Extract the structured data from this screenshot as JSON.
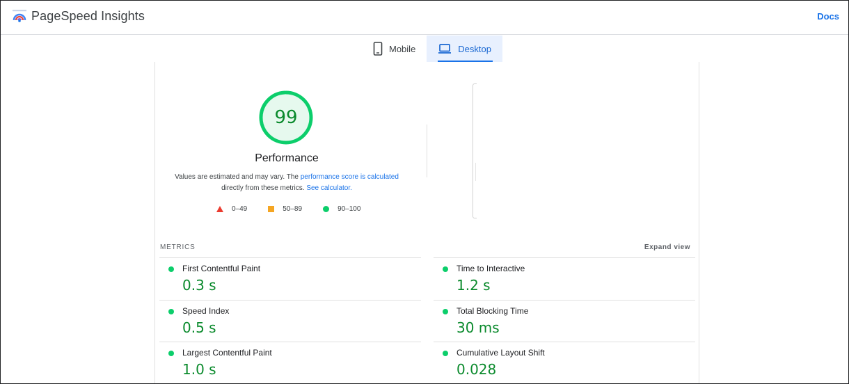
{
  "header": {
    "app_title": "PageSpeed Insights",
    "docs_label": "Docs"
  },
  "tabs": [
    {
      "label": "Mobile",
      "active": false
    },
    {
      "label": "Desktop",
      "active": true
    }
  ],
  "score": {
    "value": "99",
    "fraction": 0.99,
    "label": "Performance",
    "color": "#0cce6b"
  },
  "description": {
    "text1": "Values are estimated and may vary. The ",
    "link1": "performance score is calculated",
    "text2": "directly from these metrics. ",
    "link2": "See calculator."
  },
  "legend": [
    {
      "range": "0–49",
      "shape": "triangle",
      "color": "#eb3b2f"
    },
    {
      "range": "50–89",
      "shape": "square",
      "color": "#f5a623"
    },
    {
      "range": "90–100",
      "shape": "circle",
      "color": "#0cce6b"
    }
  ],
  "metrics": {
    "section_label": "METRICS",
    "expand_label": "Expand view",
    "items": [
      {
        "name": "First Contentful Paint",
        "value": "0.3 s"
      },
      {
        "name": "Time to Interactive",
        "value": "1.2 s"
      },
      {
        "name": "Speed Index",
        "value": "0.5 s"
      },
      {
        "name": "Total Blocking Time",
        "value": "30 ms"
      },
      {
        "name": "Largest Contentful Paint",
        "value": "1.0 s"
      },
      {
        "name": "Cumulative Layout Shift",
        "value": "0.028"
      }
    ]
  }
}
